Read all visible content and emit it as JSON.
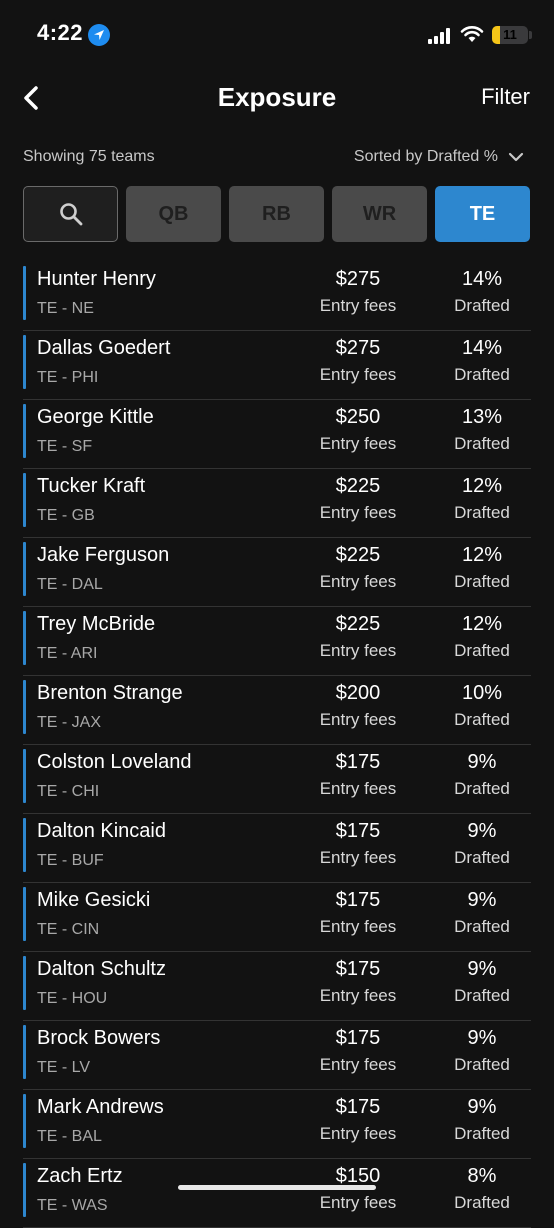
{
  "status": {
    "time": "4:22",
    "battery": "11"
  },
  "nav": {
    "title": "Exposure",
    "filter_label": "Filter"
  },
  "summary": {
    "showing": "Showing 75 teams",
    "sort": "Sorted by Drafted %"
  },
  "positions": [
    "QB",
    "RB",
    "WR",
    "TE"
  ],
  "active_position": "TE",
  "colors": {
    "accent": "#2d87cf",
    "background": "#121212"
  },
  "players": [
    {
      "name": "Hunter Henry",
      "pos": "TE - NE",
      "fee": "$275",
      "fee_label": "Entry fees",
      "pct": "14%",
      "pct_label": "Drafted"
    },
    {
      "name": "Dallas Goedert",
      "pos": "TE - PHI",
      "fee": "$275",
      "fee_label": "Entry fees",
      "pct": "14%",
      "pct_label": "Drafted"
    },
    {
      "name": "George Kittle",
      "pos": "TE - SF",
      "fee": "$250",
      "fee_label": "Entry fees",
      "pct": "13%",
      "pct_label": "Drafted"
    },
    {
      "name": "Tucker Kraft",
      "pos": "TE - GB",
      "fee": "$225",
      "fee_label": "Entry fees",
      "pct": "12%",
      "pct_label": "Drafted"
    },
    {
      "name": "Jake Ferguson",
      "pos": "TE - DAL",
      "fee": "$225",
      "fee_label": "Entry fees",
      "pct": "12%",
      "pct_label": "Drafted"
    },
    {
      "name": "Trey McBride",
      "pos": "TE - ARI",
      "fee": "$225",
      "fee_label": "Entry fees",
      "pct": "12%",
      "pct_label": "Drafted"
    },
    {
      "name": "Brenton Strange",
      "pos": "TE - JAX",
      "fee": "$200",
      "fee_label": "Entry fees",
      "pct": "10%",
      "pct_label": "Drafted"
    },
    {
      "name": "Colston Loveland",
      "pos": "TE - CHI",
      "fee": "$175",
      "fee_label": "Entry fees",
      "pct": "9%",
      "pct_label": "Drafted"
    },
    {
      "name": "Dalton Kincaid",
      "pos": "TE - BUF",
      "fee": "$175",
      "fee_label": "Entry fees",
      "pct": "9%",
      "pct_label": "Drafted"
    },
    {
      "name": "Mike Gesicki",
      "pos": "TE - CIN",
      "fee": "$175",
      "fee_label": "Entry fees",
      "pct": "9%",
      "pct_label": "Drafted"
    },
    {
      "name": "Dalton Schultz",
      "pos": "TE - HOU",
      "fee": "$175",
      "fee_label": "Entry fees",
      "pct": "9%",
      "pct_label": "Drafted"
    },
    {
      "name": "Brock Bowers",
      "pos": "TE - LV",
      "fee": "$175",
      "fee_label": "Entry fees",
      "pct": "9%",
      "pct_label": "Drafted"
    },
    {
      "name": "Mark Andrews",
      "pos": "TE - BAL",
      "fee": "$175",
      "fee_label": "Entry fees",
      "pct": "9%",
      "pct_label": "Drafted"
    },
    {
      "name": "Zach Ertz",
      "pos": "TE - WAS",
      "fee": "$150",
      "fee_label": "Entry fees",
      "pct": "8%",
      "pct_label": "Drafted"
    }
  ]
}
